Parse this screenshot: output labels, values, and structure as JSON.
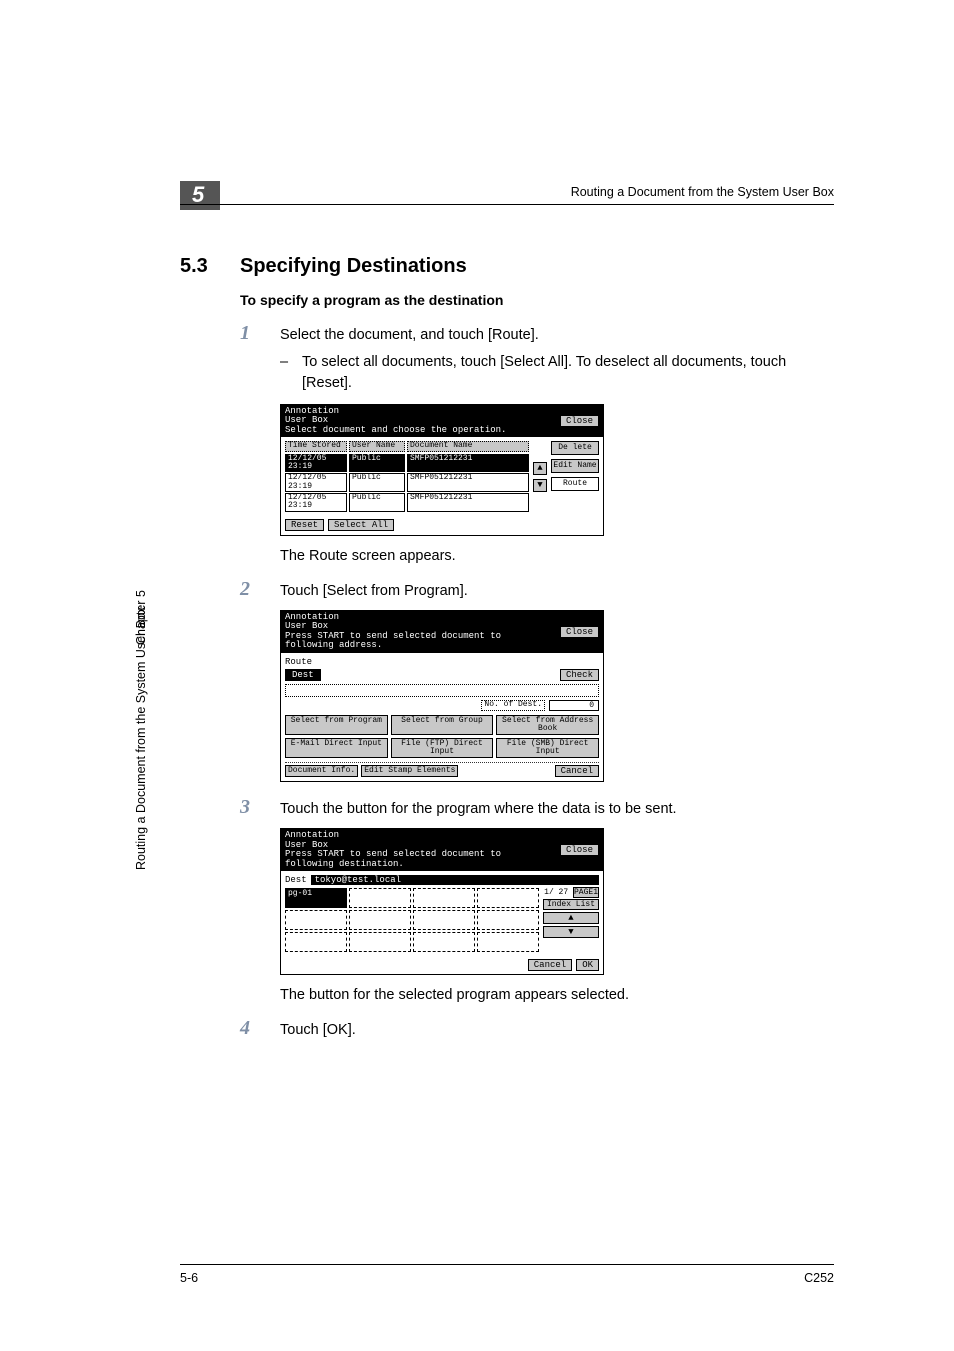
{
  "chapter_num": "5",
  "running_head": "Routing a Document from the System User Box",
  "section": {
    "num": "5.3",
    "title": "Specifying Destinations"
  },
  "sub_heading": "To specify a program as the destination",
  "steps": {
    "1": {
      "text": "Select the document, and touch [Route].",
      "bullet": "To select all documents, touch [Select All]. To deselect all documents, touch [Reset].",
      "result": "The Route screen appears."
    },
    "2": {
      "text": "Touch [Select from Program]."
    },
    "3": {
      "text": "Touch the button for the program where the data is to be sent.",
      "result": "The button for the selected program appears selected."
    },
    "4": {
      "text": "Touch [OK]."
    }
  },
  "panelA": {
    "title1": "Annotation",
    "title2": "User Box",
    "subtitle": "Select document and choose the operation.",
    "close": "Close",
    "cols": {
      "time": "Time Stored",
      "user": "User Name",
      "doc": "Document Name"
    },
    "rows": [
      {
        "time": "12/12/05 23:19",
        "user": "Public",
        "doc": "SMFP051212231"
      },
      {
        "time": "12/12/05 23:19",
        "user": "Public",
        "doc": "SMFP051212231"
      },
      {
        "time": "12/12/05 23:19",
        "user": "Public",
        "doc": "SMFP051212231"
      }
    ],
    "side": {
      "delete": "De lete",
      "edit": "Edit Name",
      "route": "Route"
    },
    "reset": "Reset",
    "select_all": "Select All"
  },
  "panelB": {
    "title1": "Annotation",
    "title2": "User Box",
    "subtitle1": "Press START to send selected document to",
    "subtitle2": "following address.",
    "close": "Close",
    "route": "Route",
    "dest_tab": "Dest",
    "check": "Check",
    "no_of_dest": "No. of Dest.",
    "count": "0",
    "buttons": [
      "Select from Program",
      "Select from Group",
      "Select from Address Book",
      "E-Mail Direct Input",
      "File (FTP) Direct Input",
      "File (SMB) Direct Input"
    ],
    "doc_info": "Document Info.",
    "edit_stamp": "Edit Stamp Elements",
    "cancel": "Cancel"
  },
  "panelC": {
    "title1": "Annotation",
    "title2": "User Box",
    "subtitle1": "Press START to send selected document to",
    "subtitle2": "following destination.",
    "close": "Close",
    "dest_label": "Dest",
    "dest_value": "tokyo@test.local",
    "selected": "pg-01",
    "page_frac": "1/ 27",
    "page_btn": "PAGE1",
    "index": "Index List",
    "cancel": "Cancel",
    "ok": "OK"
  },
  "side": {
    "main": "Routing a Document from the System User Box",
    "chapter": "Chapter 5"
  },
  "footer": {
    "left": "5-6",
    "right": "C252"
  }
}
